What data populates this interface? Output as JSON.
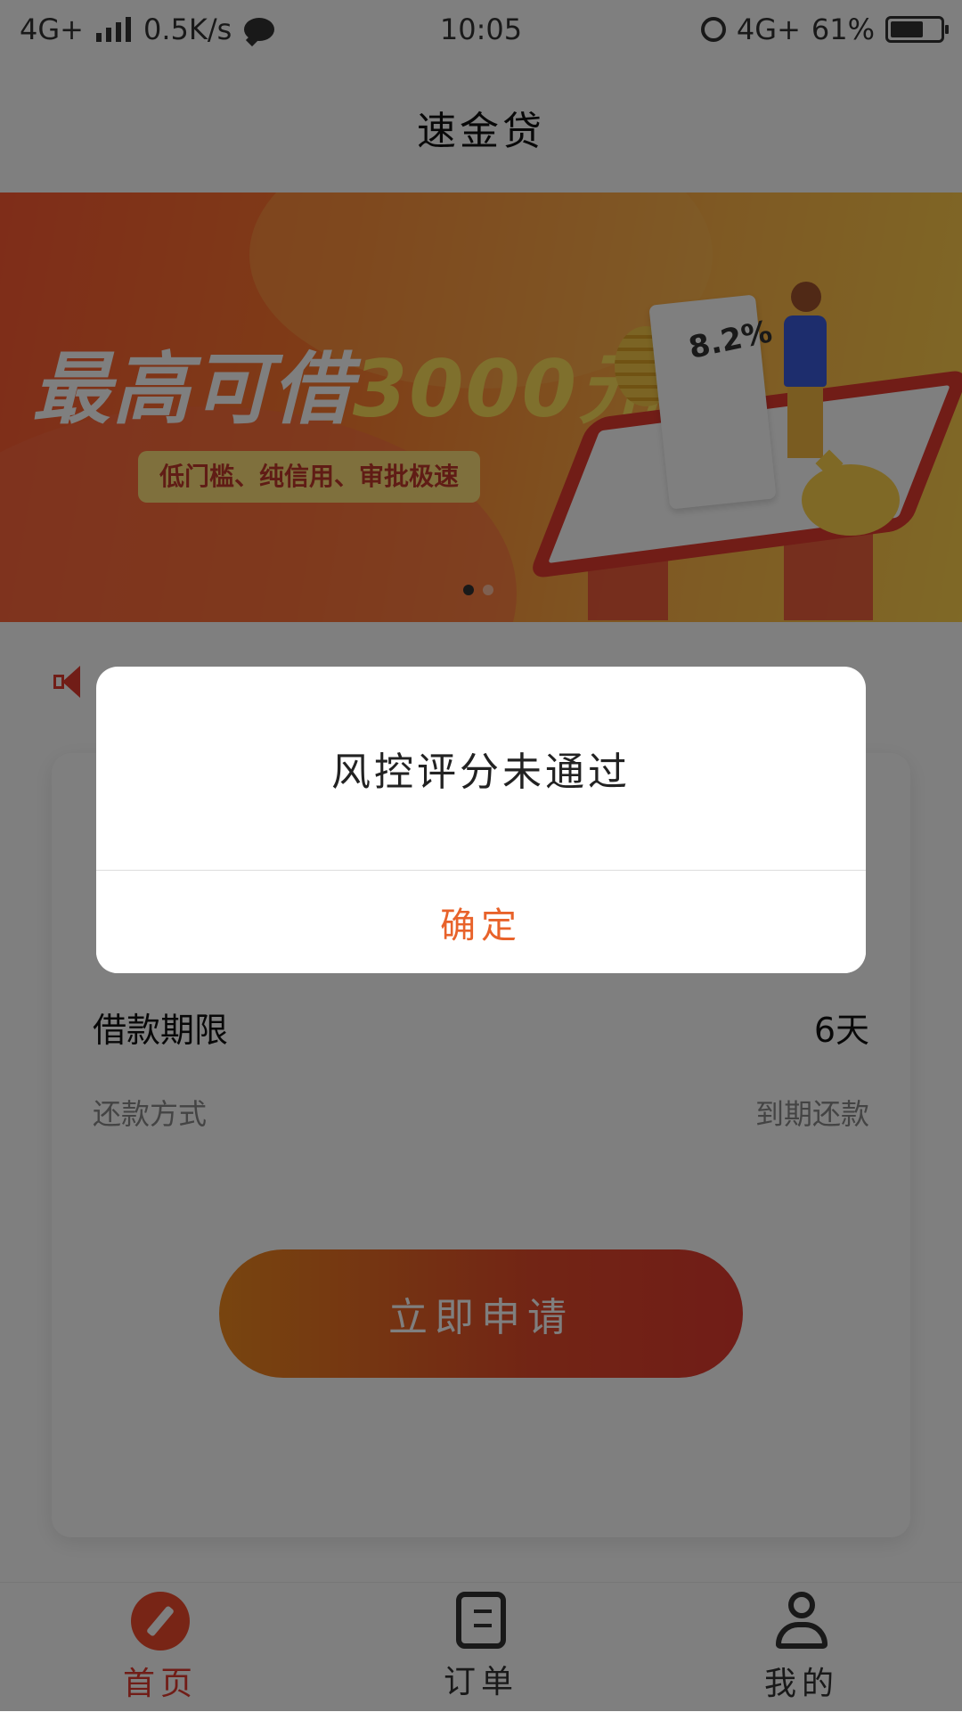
{
  "status_bar": {
    "network_left": "4G+",
    "speed": "0.5K/s",
    "time": "10:05",
    "network_right": "4G+",
    "battery": "61%"
  },
  "header": {
    "title": "速金贷"
  },
  "banner": {
    "headline_prefix": "最高可借",
    "headline_amount": "3000元",
    "tagline": "低门槛、纯信用、审批极速",
    "rate": "8.2%",
    "dots_total": 2,
    "dots_active_index": 0
  },
  "loan_card": {
    "term_label": "借款期限",
    "term_value": "6天",
    "repay_label": "还款方式",
    "repay_value": "到期还款",
    "apply_button": "立即申请"
  },
  "tabbar": {
    "items": [
      {
        "label": "首页",
        "icon": "compass-icon",
        "active": true
      },
      {
        "label": "订单",
        "icon": "clipboard-icon",
        "active": false
      },
      {
        "label": "我的",
        "icon": "person-icon",
        "active": false
      }
    ]
  },
  "dialog": {
    "message": "风控评分未通过",
    "confirm_label": "确定"
  },
  "colors": {
    "accent": "#e23a2f",
    "dialog_confirm": "#e8622a"
  }
}
